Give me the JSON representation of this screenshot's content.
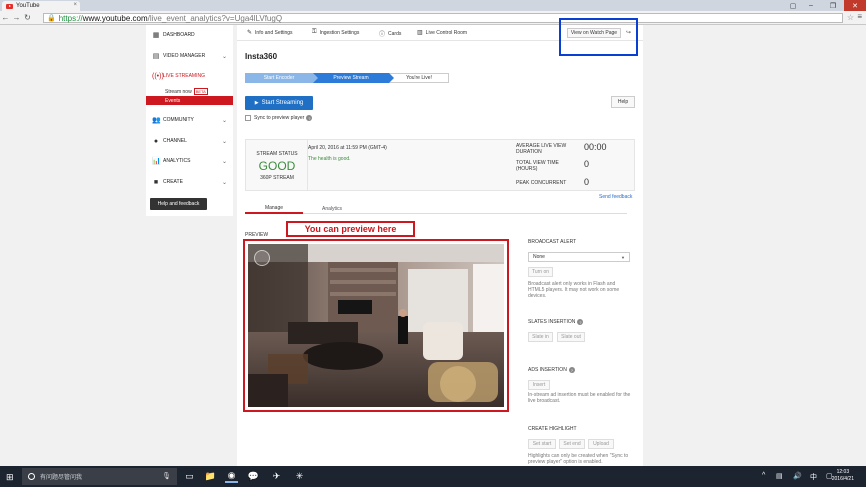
{
  "browser": {
    "tab_title": "YouTube",
    "tab_close": "×",
    "url_scheme": "https://",
    "url_host": "www.youtube.com",
    "url_path": "/live_event_analytics?v=Uga4lLVfugQ"
  },
  "sidebar": {
    "items": [
      {
        "label": "DASHBOARD",
        "icon": "dashboard-icon"
      },
      {
        "label": "VIDEO MANAGER",
        "icon": "video-manager-icon"
      },
      {
        "label": "LIVE STREAMING",
        "icon": "live-icon"
      },
      {
        "label": "COMMUNITY",
        "icon": "community-icon"
      },
      {
        "label": "CHANNEL",
        "icon": "channel-icon"
      },
      {
        "label": "ANALYTICS",
        "icon": "analytics-icon"
      },
      {
        "label": "CREATE",
        "icon": "create-icon"
      }
    ],
    "stream_now": "Stream now",
    "beta": "BETA",
    "events": "Events",
    "help_feedback": "Help and feedback"
  },
  "topnav": {
    "info": "Info and Settings",
    "ingestion": "Ingestion Settings",
    "cards": "Cards",
    "live_control": "Live Control Room",
    "view_on_watch": "View on Watch Page"
  },
  "event": {
    "title": "Insta360",
    "steps": [
      "Start Encoder",
      "Preview Stream",
      "You're Live!"
    ],
    "start_streaming": "Start Streaming",
    "help": "Help",
    "sync_label": "Sync to preview player"
  },
  "status": {
    "label": "STREAM STATUS",
    "value": "GOOD",
    "resolution": "360P STREAM",
    "date": "April 20, 2016 at 11:59 PM (GMT-4)",
    "health": "The health is good.",
    "metrics": [
      {
        "label": "AVERAGE LIVE VIEW DURATION",
        "value": "00:00"
      },
      {
        "label": "TOTAL VIEW TIME (HOURS)",
        "value": "0"
      },
      {
        "label": "PEAK CONCURRENT",
        "value": "0"
      }
    ],
    "send_feedback": "Send feedback"
  },
  "tabs": {
    "manage": "Manage",
    "analytics": "Analytics"
  },
  "preview": {
    "label": "PREVIEW",
    "annotation": "You can preview here"
  },
  "broadcast": {
    "alert_title": "BROADCAST ALERT",
    "alert_value": "None",
    "turn_on": "Turn on",
    "alert_note": "Broadcast alert only works in Flash and HTML5 players. It may not work on some devices.",
    "slates_title": "SLATES INSERTION",
    "slate_in": "Slate in",
    "slate_out": "Slate out",
    "ads_title": "ADS INSERTION",
    "insert": "Insert",
    "ads_note": "In-stream ad insertion must be enabled for the live broadcast.",
    "highlight_title": "CREATE HIGHLIGHT",
    "set_start": "Set start",
    "set_end": "Set end",
    "upload": "Upload",
    "highlight_note": "Highlights can only be created when \"Sync to preview player\" option is enabled."
  },
  "taskbar": {
    "search_placeholder": "有问题尽管问我",
    "ime": "中",
    "time": "12:03",
    "date": "2016/4/21"
  }
}
